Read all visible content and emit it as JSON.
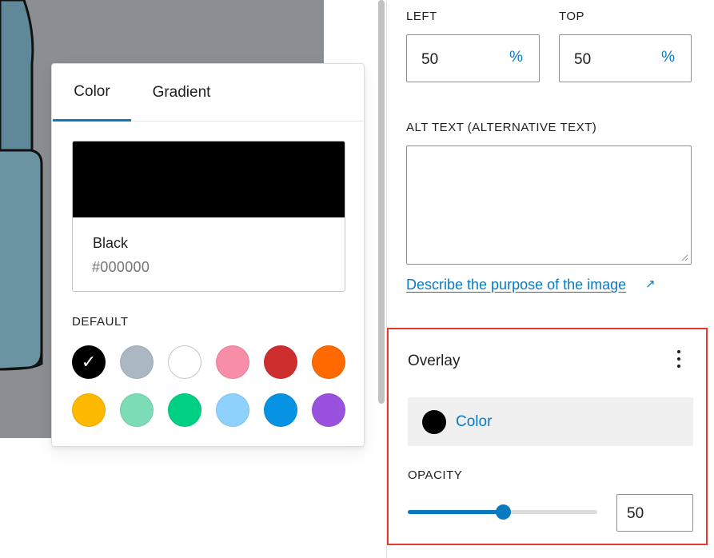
{
  "popover": {
    "tabs": [
      {
        "label": "Color",
        "active": true
      },
      {
        "label": "Gradient",
        "active": false
      }
    ],
    "selected": {
      "name": "Black",
      "hex": "#000000"
    },
    "default_label": "DEFAULT",
    "palette": [
      {
        "color": "#000000",
        "selected": true,
        "check": "✓"
      },
      {
        "color": "#abb8c3",
        "selected": false
      },
      {
        "color": "#ffffff",
        "selected": false
      },
      {
        "color": "#f78da7",
        "selected": false
      },
      {
        "color": "#cf2e2e",
        "selected": false
      },
      {
        "color": "#ff6900",
        "selected": false
      },
      {
        "color": "#fcb900",
        "selected": false
      },
      {
        "color": "#7bdcb5",
        "selected": false
      },
      {
        "color": "#00d084",
        "selected": false
      },
      {
        "color": "#8ed1fc",
        "selected": false
      },
      {
        "color": "#0693e3",
        "selected": false
      },
      {
        "color": "#9b51e0",
        "selected": false
      }
    ]
  },
  "sidebar": {
    "left": {
      "label": "LEFT",
      "value": "50",
      "unit": "%"
    },
    "top": {
      "label": "TOP",
      "value": "50",
      "unit": "%"
    },
    "alt_text": {
      "label": "ALT TEXT (ALTERNATIVE TEXT)",
      "value": ""
    },
    "describe_link": "Describe the purpose of the image",
    "describe_link_icon": "↗",
    "overlay": {
      "title": "Overlay",
      "color_label": "Color",
      "color_value": "#000000",
      "opacity_label": "OPACITY",
      "opacity_value": "50",
      "opacity_max": 100
    }
  },
  "colors": {
    "accent": "#0a7ac0",
    "highlight_border": "#e53a2c"
  }
}
